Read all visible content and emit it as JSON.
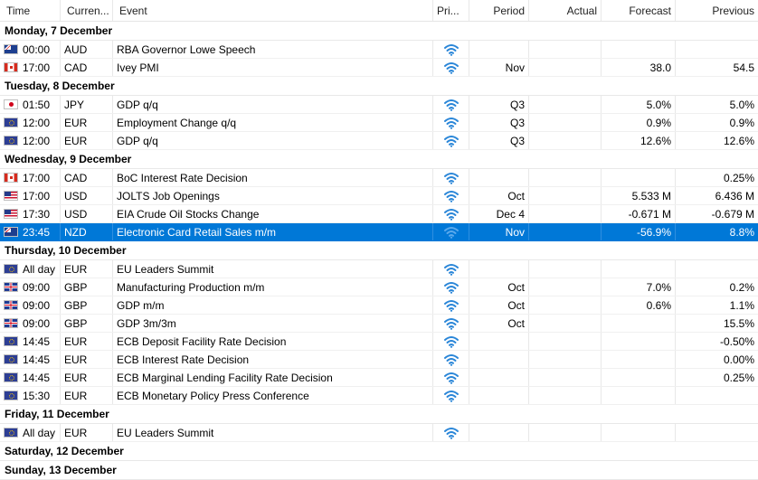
{
  "accent_color": "#0078d7",
  "priority_icon_color": "#2a86d8",
  "columns": {
    "time": "Time",
    "currency": "Curren...",
    "event": "Event",
    "priority": "Pri...",
    "period": "Period",
    "actual": "Actual",
    "forecast": "Forecast",
    "previous": "Previous"
  },
  "rows": [
    {
      "type": "day",
      "label": "Monday, 7 December"
    },
    {
      "type": "event",
      "time": "00:00",
      "currency": "AUD",
      "flag": "AUD",
      "event": "RBA Governor Lowe Speech",
      "period": "",
      "actual": "",
      "forecast": "",
      "previous": ""
    },
    {
      "type": "event",
      "time": "17:00",
      "currency": "CAD",
      "flag": "CAD",
      "event": "Ivey PMI",
      "period": "Nov",
      "actual": "",
      "forecast": "38.0",
      "previous": "54.5"
    },
    {
      "type": "day",
      "label": "Tuesday, 8 December"
    },
    {
      "type": "event",
      "time": "01:50",
      "currency": "JPY",
      "flag": "JPY",
      "event": "GDP q/q",
      "period": "Q3",
      "actual": "",
      "forecast": "5.0%",
      "previous": "5.0%"
    },
    {
      "type": "event",
      "time": "12:00",
      "currency": "EUR",
      "flag": "EUR",
      "event": "Employment Change q/q",
      "period": "Q3",
      "actual": "",
      "forecast": "0.9%",
      "previous": "0.9%"
    },
    {
      "type": "event",
      "time": "12:00",
      "currency": "EUR",
      "flag": "EUR",
      "event": "GDP q/q",
      "period": "Q3",
      "actual": "",
      "forecast": "12.6%",
      "previous": "12.6%"
    },
    {
      "type": "day",
      "label": "Wednesday, 9 December"
    },
    {
      "type": "event",
      "time": "17:00",
      "currency": "CAD",
      "flag": "CAD",
      "event": "BoC Interest Rate Decision",
      "period": "",
      "actual": "",
      "forecast": "",
      "previous": "0.25%"
    },
    {
      "type": "event",
      "time": "17:00",
      "currency": "USD",
      "flag": "USD",
      "event": "JOLTS Job Openings",
      "period": "Oct",
      "actual": "",
      "forecast": "5.533 M",
      "previous": "6.436 M"
    },
    {
      "type": "event",
      "time": "17:30",
      "currency": "USD",
      "flag": "USD",
      "event": "EIA Crude Oil Stocks Change",
      "period": "Dec 4",
      "actual": "",
      "forecast": "-0.671 M",
      "previous": "-0.679 M"
    },
    {
      "type": "event",
      "time": "23:45",
      "currency": "NZD",
      "flag": "NZD",
      "event": "Electronic Card Retail Sales m/m",
      "period": "Nov",
      "actual": "",
      "forecast": "-56.9%",
      "previous": "8.8%",
      "selected": true
    },
    {
      "type": "day",
      "label": "Thursday, 10 December"
    },
    {
      "type": "event",
      "time": "All day",
      "currency": "EUR",
      "flag": "EUR",
      "event": "EU Leaders Summit",
      "period": "",
      "actual": "",
      "forecast": "",
      "previous": ""
    },
    {
      "type": "event",
      "time": "09:00",
      "currency": "GBP",
      "flag": "GBP",
      "event": "Manufacturing Production m/m",
      "period": "Oct",
      "actual": "",
      "forecast": "7.0%",
      "previous": "0.2%"
    },
    {
      "type": "event",
      "time": "09:00",
      "currency": "GBP",
      "flag": "GBP",
      "event": "GDP m/m",
      "period": "Oct",
      "actual": "",
      "forecast": "0.6%",
      "previous": "1.1%"
    },
    {
      "type": "event",
      "time": "09:00",
      "currency": "GBP",
      "flag": "GBP",
      "event": "GDP 3m/3m",
      "period": "Oct",
      "actual": "",
      "forecast": "",
      "previous": "15.5%"
    },
    {
      "type": "event",
      "time": "14:45",
      "currency": "EUR",
      "flag": "EUR",
      "event": "ECB Deposit Facility Rate Decision",
      "period": "",
      "actual": "",
      "forecast": "",
      "previous": "-0.50%"
    },
    {
      "type": "event",
      "time": "14:45",
      "currency": "EUR",
      "flag": "EUR",
      "event": "ECB Interest Rate Decision",
      "period": "",
      "actual": "",
      "forecast": "",
      "previous": "0.00%"
    },
    {
      "type": "event",
      "time": "14:45",
      "currency": "EUR",
      "flag": "EUR",
      "event": "ECB Marginal Lending Facility Rate Decision",
      "period": "",
      "actual": "",
      "forecast": "",
      "previous": "0.25%"
    },
    {
      "type": "event",
      "time": "15:30",
      "currency": "EUR",
      "flag": "EUR",
      "event": "ECB Monetary Policy Press Conference",
      "period": "",
      "actual": "",
      "forecast": "",
      "previous": ""
    },
    {
      "type": "day",
      "label": "Friday, 11 December"
    },
    {
      "type": "event",
      "time": "All day",
      "currency": "EUR",
      "flag": "EUR",
      "event": "EU Leaders Summit",
      "period": "",
      "actual": "",
      "forecast": "",
      "previous": ""
    },
    {
      "type": "day",
      "label": "Saturday, 12 December"
    },
    {
      "type": "day",
      "label": "Sunday, 13 December"
    }
  ]
}
